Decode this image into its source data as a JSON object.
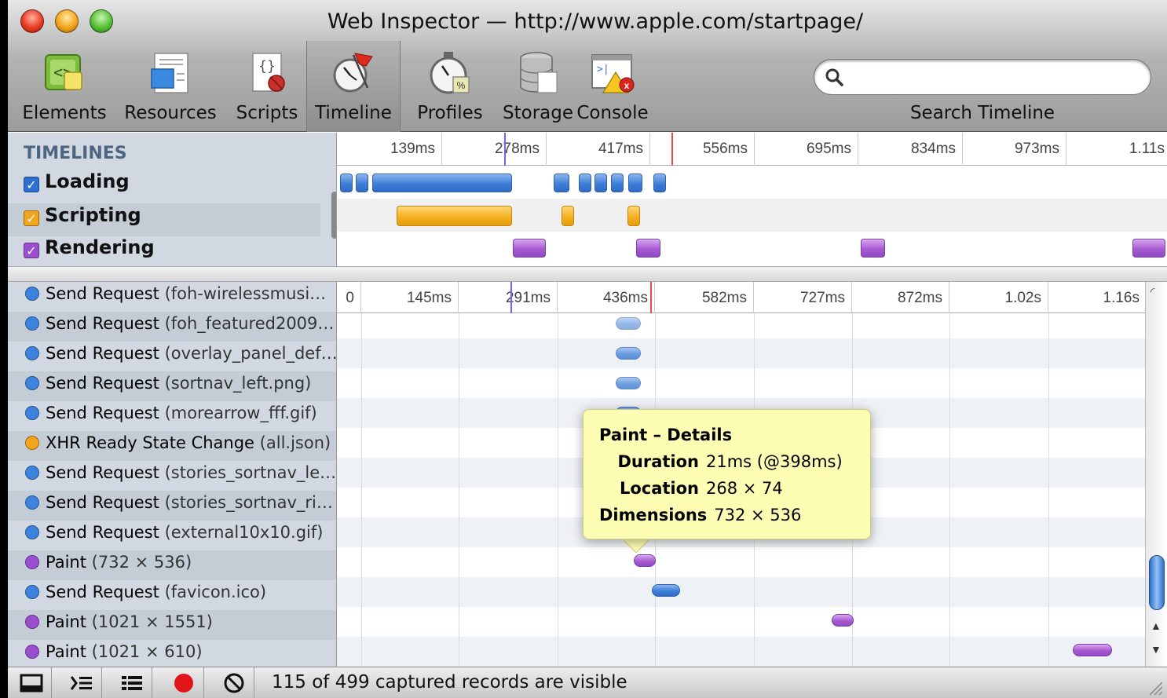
{
  "window": {
    "title": "Web Inspector — http://www.apple.com/startpage/"
  },
  "toolbar": {
    "items": [
      {
        "label": "Elements",
        "icon": "elements-icon"
      },
      {
        "label": "Resources",
        "icon": "resources-icon"
      },
      {
        "label": "Scripts",
        "icon": "scripts-icon"
      },
      {
        "label": "Timeline",
        "icon": "timeline-icon",
        "selected": true
      },
      {
        "label": "Profiles",
        "icon": "profiles-icon"
      },
      {
        "label": "Storage",
        "icon": "storage-icon"
      },
      {
        "label": "Console",
        "icon": "console-icon"
      }
    ],
    "search": {
      "value": "",
      "placeholder": "",
      "label": "Search Timeline"
    }
  },
  "timelines": {
    "header": "TIMELINES",
    "categories": [
      {
        "label": "Loading",
        "checked": true,
        "color": "#3f7fd8"
      },
      {
        "label": "Scripting",
        "checked": true,
        "color": "#f5b021"
      },
      {
        "label": "Rendering",
        "checked": true,
        "color": "#a75ad2"
      }
    ],
    "ticks": [
      "139ms",
      "278ms",
      "417ms",
      "556ms",
      "695ms",
      "834ms",
      "973ms",
      "1.11s"
    ]
  },
  "records": {
    "ticks": [
      "0",
      "145ms",
      "291ms",
      "436ms",
      "582ms",
      "727ms",
      "872ms",
      "1.02s",
      "1.16s"
    ],
    "items": [
      {
        "name": "Send Request",
        "detail": "(foh-wirelessmusi…",
        "type": "loading"
      },
      {
        "name": "Send Request",
        "detail": "(foh_featured2009…",
        "type": "loading"
      },
      {
        "name": "Send Request",
        "detail": "(overlay_panel_def…",
        "type": "loading"
      },
      {
        "name": "Send Request",
        "detail": "(sortnav_left.png)",
        "type": "loading"
      },
      {
        "name": "Send Request",
        "detail": "(morearrow_fff.gif)",
        "type": "loading"
      },
      {
        "name": "XHR Ready State Change",
        "detail": "(all.json)",
        "type": "scripting"
      },
      {
        "name": "Send Request",
        "detail": "(stories_sortnav_le…",
        "type": "loading"
      },
      {
        "name": "Send Request",
        "detail": "(stories_sortnav_ri…",
        "type": "loading"
      },
      {
        "name": "Send Request",
        "detail": "(external10x10.gif)",
        "type": "loading"
      },
      {
        "name": "Paint",
        "detail": "(732 × 536)",
        "type": "rendering"
      },
      {
        "name": "Send Request",
        "detail": "(favicon.ico)",
        "type": "loading"
      },
      {
        "name": "Paint",
        "detail": "(1021 × 1551)",
        "type": "rendering"
      },
      {
        "name": "Paint",
        "detail": "(1021 × 610)",
        "type": "rendering"
      }
    ]
  },
  "tooltip": {
    "title": "Paint – Details",
    "rows": [
      {
        "key": "Duration",
        "value": "21ms (@398ms)"
      },
      {
        "key": "Location",
        "value": "268 × 74"
      },
      {
        "key": "Dimensions",
        "value": "732 × 536"
      }
    ]
  },
  "status": {
    "text": "115 of 499 captured records are visible",
    "buttons": [
      "dock-icon",
      "large-rows-icon",
      "overview-icon",
      "record-icon",
      "clear-icon"
    ],
    "record_color": "#e0141a"
  }
}
